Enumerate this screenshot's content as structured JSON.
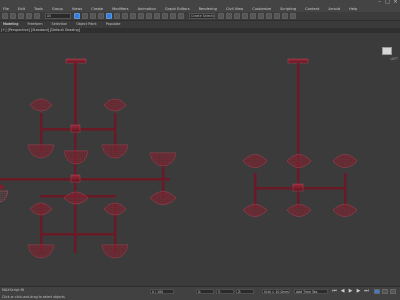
{
  "menu": [
    "File",
    "Edit",
    "Tools",
    "Group",
    "Views",
    "Create",
    "Modifiers",
    "Animation",
    "Graph Editors",
    "Rendering",
    "Civil View",
    "Customize",
    "Scripting",
    "Content",
    "Arnold",
    "Help"
  ],
  "toolbar": {
    "selection_filter": "All",
    "named_selection": "Create Selection Se"
  },
  "ribbon_tabs": [
    "Modeling",
    "Freeform",
    "Selection",
    "Object Paint",
    "Populate"
  ],
  "viewport": {
    "label": "[+] [Perspective] [Standard] [Default Shading]",
    "viewcube_label": "LEFT"
  },
  "statusbar": {
    "script_prompt": "MAXScript Mi",
    "frame_counter": "0 / 100",
    "coord_x": "X:",
    "coord_y": "Y:",
    "coord_z": "Z:",
    "grid": "Grid = 10,0mm",
    "add_time_tag": "Add Time Tag",
    "status_text": "Click or click-and-drag to select objects"
  },
  "colors": {
    "background": "#3b3b3b",
    "object_red": "#7a1f2b",
    "wire": "#b0485a",
    "accent_blue": "#3a7bd5"
  }
}
